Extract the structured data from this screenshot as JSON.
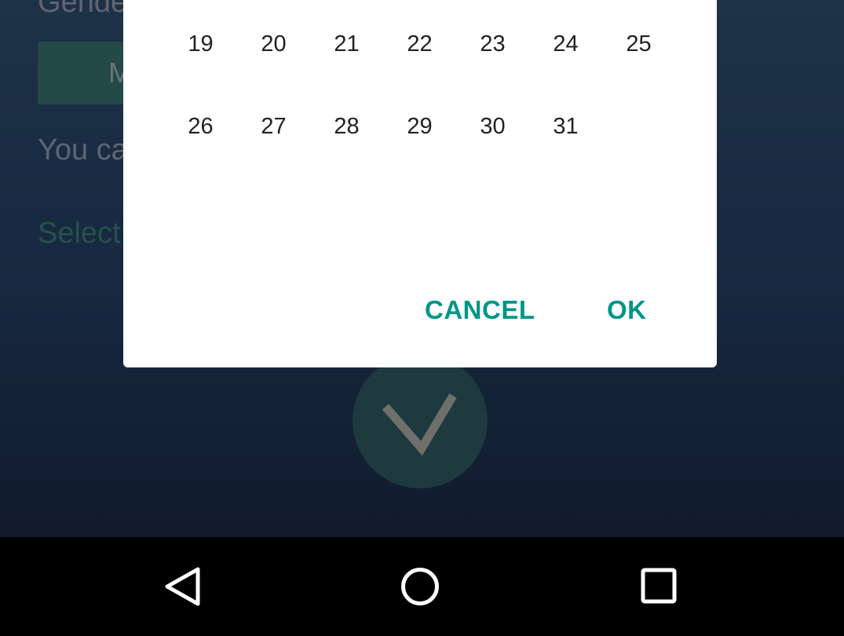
{
  "background": {
    "gender_label": "Gende",
    "gender_button": "M",
    "hint_text": "You ca",
    "select_label": "Select"
  },
  "date_picker": {
    "weeks": [
      [
        "19",
        "20",
        "21",
        "22",
        "23",
        "24",
        "25"
      ],
      [
        "26",
        "27",
        "28",
        "29",
        "30",
        "31"
      ]
    ],
    "cancel_label": "CANCEL",
    "ok_label": "OK",
    "accent_color": "#009688"
  },
  "fab": {
    "icon": "check-icon"
  },
  "nav_bar": {
    "icons": [
      "back-icon",
      "home-icon",
      "recents-icon"
    ]
  }
}
